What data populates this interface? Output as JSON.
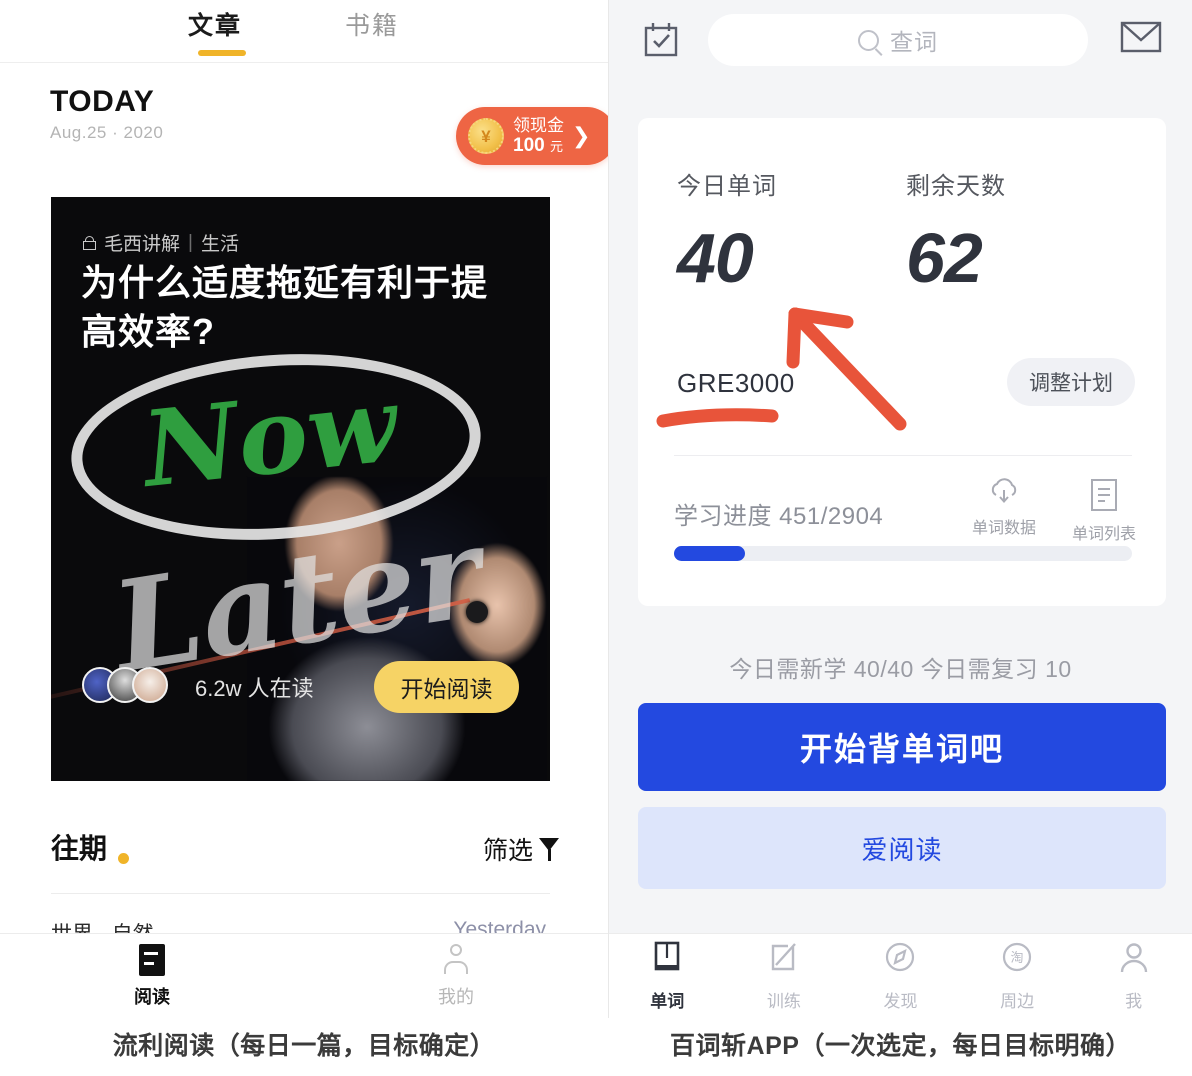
{
  "left_app": {
    "tabs": [
      {
        "label": "文章",
        "active": true
      },
      {
        "label": "书籍",
        "active": false
      }
    ],
    "today": {
      "title": "TODAY",
      "date": "Aug.25 · 2020"
    },
    "cash_badge": {
      "coin_symbol": "¥",
      "line1": "领现金",
      "amount": "100",
      "unit": "元",
      "chevron": "❯"
    },
    "hero": {
      "lock_icon": "lock-icon",
      "author": "毛西讲解",
      "separator": "|",
      "category": "生活",
      "title": "为什么适度拖延有利于提高效率?",
      "art_word_now": "Now",
      "art_word_later": "Later",
      "readers": "6.2w 人在读",
      "read_button": "开始阅读"
    },
    "past": {
      "title": "往期",
      "filter_label": "筛选",
      "item_tag": "世界 · 自然",
      "item_en": "Yesterday"
    },
    "nav": [
      {
        "label": "阅读",
        "icon": "document-icon",
        "active": true
      },
      {
        "label": "我的",
        "icon": "person-icon",
        "active": false
      }
    ]
  },
  "right_app": {
    "topbar": {
      "calendar_icon": "calendar-check-icon",
      "mail_icon": "mail-icon",
      "search_icon": "search-icon",
      "search_placeholder": "查词"
    },
    "card": {
      "stats": [
        {
          "label": "今日单词",
          "value": "40"
        },
        {
          "label": "剩余天数",
          "value": "62"
        }
      ],
      "book_name": "GRE3000",
      "adjust_button": "调整计划",
      "progress_label": "学习进度 451/2904",
      "progress_done": 451,
      "progress_total": 2904,
      "progress_percent": 15.5,
      "actions": [
        {
          "label": "单词数据",
          "icon": "cloud-download-icon"
        },
        {
          "label": "单词列表",
          "icon": "list-document-icon"
        }
      ]
    },
    "todo_line": "今日需新学 40/40  今日需复习 10",
    "primary_button": "开始背单词吧",
    "secondary_button": "爱阅读",
    "nav": [
      {
        "label": "单词",
        "icon": "book-icon",
        "active": true
      },
      {
        "label": "训练",
        "icon": "pencil-square-icon",
        "active": false
      },
      {
        "label": "发现",
        "icon": "compass-icon",
        "active": false
      },
      {
        "label": "周边",
        "icon": "taobao-circle-icon",
        "active": false
      },
      {
        "label": "我",
        "icon": "person-icon",
        "active": false
      }
    ]
  },
  "annotations": {
    "color": "#e8543a",
    "arrow": "arrow-pointing-to-today-word-count",
    "underline": "underline-under-GRE3000"
  },
  "captions": {
    "left": "流利阅读（每日一篇，目标确定）",
    "right": "百词斩APP（一次选定，每日目标明确）"
  },
  "colors": {
    "left_accent": "#f0b429",
    "cash_orange": "#ee6544",
    "read_button_yellow": "#f6d365",
    "right_blue": "#2349e0",
    "right_bg": "#f4f5f7",
    "annotation_red": "#e8543a",
    "green_handwriting": "#2f9e3f"
  }
}
